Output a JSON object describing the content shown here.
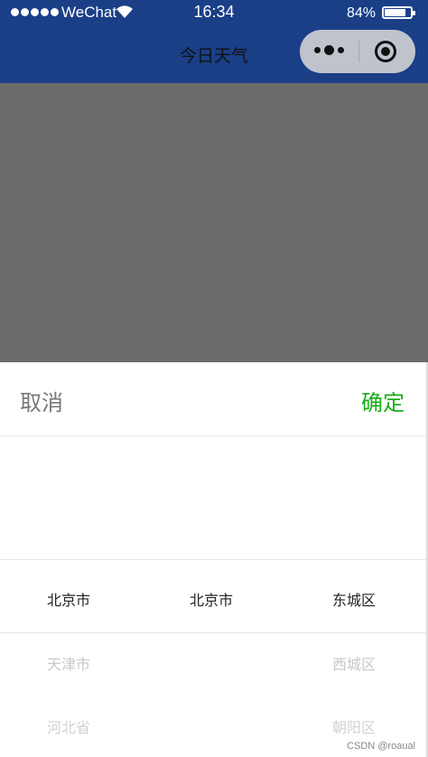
{
  "status_bar": {
    "carrier": "WeChat",
    "time": "16:34",
    "battery_percent": "84%",
    "battery_level": 0.84
  },
  "nav": {
    "title": "今日天气"
  },
  "picker": {
    "cancel_label": "取消",
    "confirm_label": "确定",
    "confirm_color": "#1aad19",
    "columns": [
      {
        "items": [
          "北京市",
          "天津市",
          "河北省"
        ]
      },
      {
        "items": [
          "北京市",
          "",
          ""
        ]
      },
      {
        "items": [
          "东城区",
          "西城区",
          "朝阳区"
        ]
      }
    ]
  },
  "watermark": "CSDN @roaual"
}
